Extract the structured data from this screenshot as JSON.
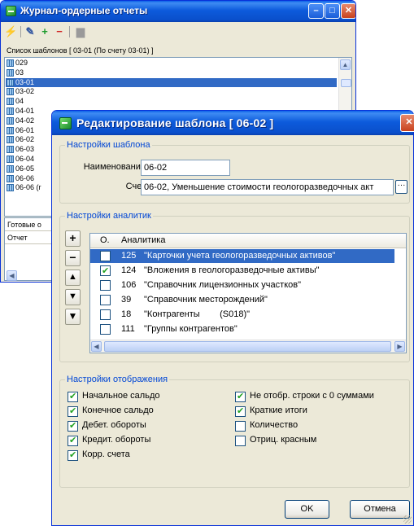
{
  "back_window": {
    "title": "Журнал-ордерные отчеты",
    "list_label": "Список шаблонов [ 03-01 (По счету 03-01) ]",
    "items": [
      "029",
      "03",
      "03-01",
      "03-02",
      "04",
      "04-01",
      "04-02",
      "06-01",
      "06-02",
      "06-03",
      "06-04",
      "06-05",
      "06-06",
      "06-06 (r"
    ],
    "selected_item": "03-01",
    "lower_labels": [
      "Готовые о",
      "Отчет"
    ]
  },
  "dialog": {
    "title": "Редактирование шаблона [ 06-02 ]",
    "template_settings": {
      "legend": "Настройки шаблона",
      "name_label": "Наименование",
      "name_value": "06-02",
      "account_label": "Счет",
      "account_value": "06-02, Уменьшение стоимости геологоразведочных акт"
    },
    "analytics_settings": {
      "legend": "Настройки аналитик",
      "col_o": "О.",
      "col_analytics": "Аналитика",
      "rows": [
        {
          "num": "125",
          "name": "\"Карточки учета геологоразведочных активов\"",
          "checked": false,
          "selected": true
        },
        {
          "num": "124",
          "name": "\"Вложения в геологоразведочные активы\"",
          "checked": true,
          "selected": false
        },
        {
          "num": "106",
          "name": "\"Справочник лицензионных участков\"",
          "checked": false,
          "selected": false
        },
        {
          "num": "39",
          "name": "\"Справочник месторождений\"",
          "checked": false,
          "selected": false
        },
        {
          "num": "18",
          "name": "\"Контрагенты        (S018)\"",
          "checked": false,
          "selected": false
        },
        {
          "num": "111",
          "name": "\"Группы контрагентов\"",
          "checked": false,
          "selected": false
        }
      ]
    },
    "display_settings": {
      "legend": "Настройки отображения",
      "left": [
        {
          "label": "Начальное сальдо",
          "checked": true
        },
        {
          "label": "Конечное сальдо",
          "checked": true
        },
        {
          "label": "Дебет. обороты",
          "checked": true
        },
        {
          "label": "Кредит. обороты",
          "checked": true
        },
        {
          "label": "Корр. счета",
          "checked": true
        }
      ],
      "right": [
        {
          "label": "Не отобр. строки с 0 суммами",
          "checked": true
        },
        {
          "label": "Краткие итоги",
          "checked": true
        },
        {
          "label": "Количество",
          "checked": false
        },
        {
          "label": "Отриц. красным",
          "checked": false
        }
      ]
    },
    "ok_label": "OK",
    "cancel_label": "Отмена"
  }
}
